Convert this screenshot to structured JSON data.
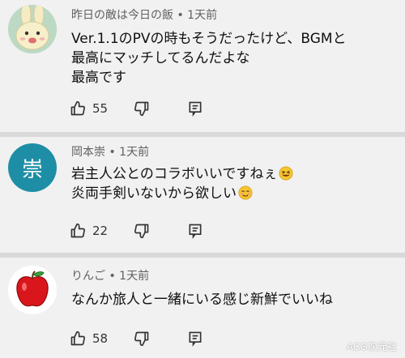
{
  "comments": [
    {
      "author": "昨日の敵は今日の飯",
      "time": "1天前",
      "lines": [
        "Ver.1.1のPVの時もそうだったけど、BGMと",
        "最高にマッチしてるんだよな",
        "最高です"
      ],
      "likes": "55",
      "avatar_icon": "rabbit-avatar"
    },
    {
      "author": "岡本崇",
      "time": "1天前",
      "avatar_letter": "崇",
      "avatar_color": "#1e8ea6",
      "lines": [
        "岩主人公とのコラボいいですねぇ",
        "炎両手剣いないから欲しい"
      ],
      "emojis": [
        "laughing-emoji",
        "smiling-emoji"
      ],
      "likes": "22"
    },
    {
      "author": "りんご",
      "time": "1天前",
      "lines": [
        "なんか旅人と一緒にいる感じ新鮮でいいね"
      ],
      "likes": "58",
      "avatar_icon": "apple-avatar"
    }
  ],
  "separator": "•",
  "watermark": "ACG次元社"
}
